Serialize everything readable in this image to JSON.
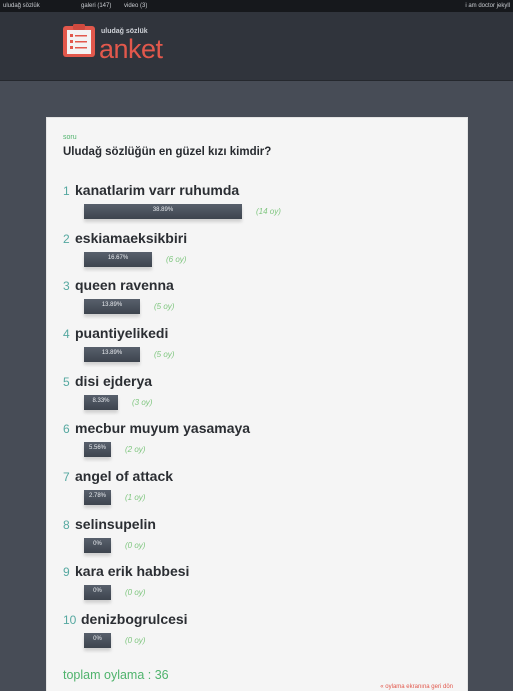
{
  "topbar": {
    "site": "uludağ sözlük",
    "gallery": "galeri (147)",
    "video": "video (3)",
    "user": "i am doctor jekyll"
  },
  "logo": {
    "small": "uludağ sözlük",
    "big": "anket"
  },
  "poll": {
    "label": "soru",
    "question": "Uludağ sözlüğün en güzel kızı kimdir?",
    "options": [
      {
        "num": "1",
        "name": "kanatlarim varr ruhumda",
        "percent": "38.89%",
        "votes": "(14 oy)",
        "share": 0.3889
      },
      {
        "num": "2",
        "name": "eskiamaeksikbiri",
        "percent": "16.67%",
        "votes": "(6 oy)",
        "share": 0.1667
      },
      {
        "num": "3",
        "name": "queen ravenna",
        "percent": "13.89%",
        "votes": "(5 oy)",
        "share": 0.1389
      },
      {
        "num": "4",
        "name": "puantiyelikedi",
        "percent": "13.89%",
        "votes": "(5 oy)",
        "share": 0.1389
      },
      {
        "num": "5",
        "name": "disi ejderya",
        "percent": "8.33%",
        "votes": "(3 oy)",
        "share": 0.0833
      },
      {
        "num": "6",
        "name": "mecbur muyum yasamaya",
        "percent": "5.56%",
        "votes": "(2 oy)",
        "share": 0.0556
      },
      {
        "num": "7",
        "name": "angel of attack",
        "percent": "2.78%",
        "votes": "(1 oy)",
        "share": 0.0278
      },
      {
        "num": "8",
        "name": "selinsupelin",
        "percent": "0%",
        "votes": "(0 oy)",
        "share": 0
      },
      {
        "num": "9",
        "name": "kara erik habbesi",
        "percent": "0%",
        "votes": "(0 oy)",
        "share": 0
      },
      {
        "num": "10",
        "name": "denizbogrulcesi",
        "percent": "0%",
        "votes": "(0 oy)",
        "share": 0
      }
    ],
    "total": "toplam oylama : 36",
    "back_link": "« oylama ekranına geri dön"
  },
  "colors": {
    "accent_green": "#4fb36c",
    "brand_red": "#e2584c",
    "bar": "#4a525e"
  },
  "icons": {
    "logo": "clipboard-list-icon"
  }
}
